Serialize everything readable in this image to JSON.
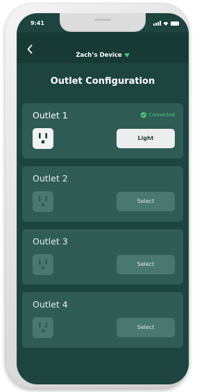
{
  "status_bar": {
    "time": "9:41"
  },
  "header": {
    "device_name": "Zach’s Device",
    "back_icon": "chevron-left-icon",
    "dropdown_icon": "caret-down-icon"
  },
  "page": {
    "title": "Outlet Configuration"
  },
  "colors": {
    "background": "#1d443e",
    "card": "#2f5c55",
    "accent_green": "#52c97b",
    "select_button": "#4a7770",
    "active_button": "#eceeed"
  },
  "outlets": [
    {
      "name": "Outlet 1",
      "status": "Connected",
      "button_label": "Light"
    },
    {
      "name": "Outlet 2",
      "status": "",
      "button_label": "Select"
    },
    {
      "name": "Outlet 3",
      "status": "",
      "button_label": "Select"
    },
    {
      "name": "Outlet 4",
      "status": "",
      "button_label": "Select"
    }
  ]
}
